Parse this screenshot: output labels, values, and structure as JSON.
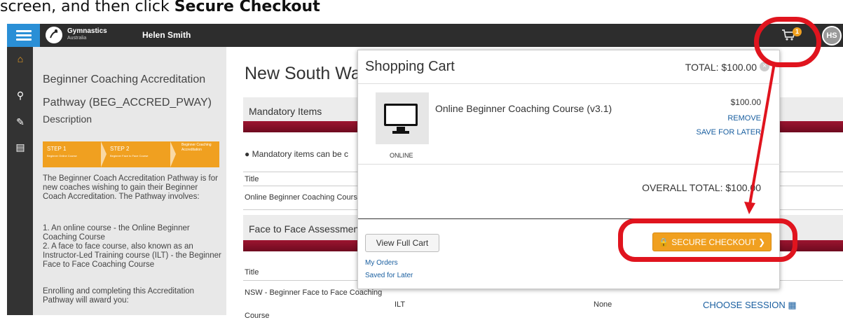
{
  "caption": {
    "prefix": "screen, and then click ",
    "bold": "Secure Checkout"
  },
  "topbar": {
    "logo_title": "Gymnastics",
    "logo_subtitle": "Australia",
    "user_name": "Helen Smith",
    "cart_count": "1",
    "avatar_initials": "HS"
  },
  "leftnav": {
    "icons": [
      "home-icon",
      "search-icon",
      "edit-icon",
      "clipboard-icon"
    ]
  },
  "sidebar": {
    "title": "Beginner Coaching Accreditation Pathway (BEG_ACCRED_PWAY)",
    "description_label": "Description",
    "steps": [
      {
        "name": "STEP 1",
        "sub": "Beginner Online Course"
      },
      {
        "name": "STEP 2",
        "sub": "Beginner Face to Face Course"
      },
      {
        "name": "Beginner Coaching Accreditation",
        "sub": ""
      }
    ],
    "para1": "The Beginner Coach Accreditation Pathway is for new coaches wishing to gain their Beginner Coach Accreditation. The Pathway involves:",
    "para2": "1. An online course - the Online Beginner Coaching Course\n2. A face to face course, also known as an Instructor-Led Training course (ILT) - the Beginner Face to Face Coaching Course",
    "para3": "Enrolling and completing this Accreditation Pathway will award you:"
  },
  "main": {
    "page_title": "New South Wales",
    "mandatory_label": "Mandatory Items",
    "info_note": "Mandatory items can be c",
    "title_header": "Title",
    "row1_title": "Online Beginner Coaching Cours",
    "face_label": "Face to Face Assessmen",
    "title_header2": "Title",
    "row2_title": "NSW - Beginner Face to Face Coaching",
    "row2_title_cont": "Course",
    "row2_type": "ILT",
    "row2_status": "None",
    "choose_session": "CHOOSE SESSION"
  },
  "cart": {
    "title": "Shopping Cart",
    "total": "TOTAL: $100.00",
    "product_name": "Online Beginner Coaching Course (v3.1)",
    "product_type": "ONLINE",
    "price": "$100.00",
    "remove": "REMOVE",
    "save_for_later": "SAVE FOR LATER",
    "overall_total": "OVERALL TOTAL: $100.00",
    "view_full_cart": "View Full Cart",
    "secure_checkout": "SECURE CHECKOUT",
    "my_orders": "My Orders",
    "saved_for_later": "Saved for Later"
  },
  "colors": {
    "accent_blue": "#2a8fd6",
    "checkout_orange": "#f0a020",
    "link_blue": "#1a5fa0",
    "annotation_red": "#e0141e",
    "bar_red": "#9c1530"
  }
}
